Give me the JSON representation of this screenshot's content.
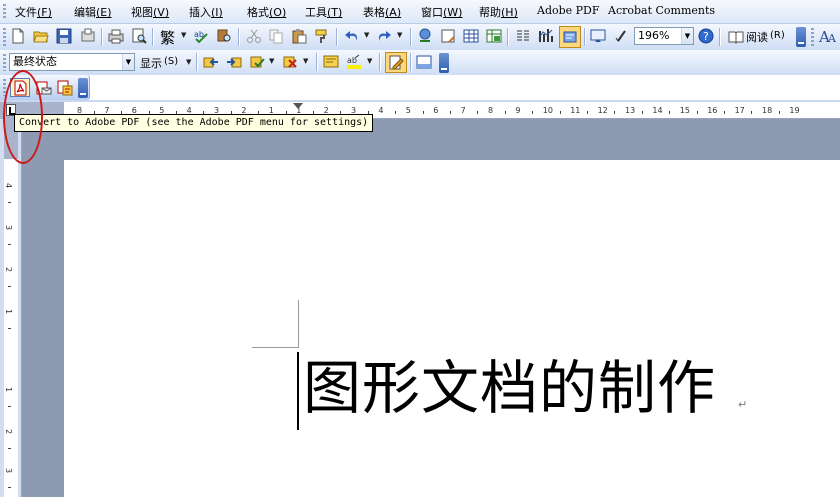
{
  "menubar": {
    "items": [
      {
        "label": "文件",
        "mnemonic": "(F)"
      },
      {
        "label": "编辑",
        "mnemonic": "(E)"
      },
      {
        "label": "视图",
        "mnemonic": "(V)"
      },
      {
        "label": "插入",
        "mnemonic": "(I)"
      },
      {
        "label": "格式",
        "mnemonic": "(O)"
      },
      {
        "label": "工具",
        "mnemonic": "(T)"
      },
      {
        "label": "表格",
        "mnemonic": "(A)"
      },
      {
        "label": "窗口",
        "mnemonic": "(W)"
      },
      {
        "label": "帮助",
        "mnemonic": "(H)"
      },
      {
        "label": "Adobe PDF",
        "mnemonic": ""
      },
      {
        "label": "Acrobat Comments",
        "mnemonic": ""
      }
    ]
  },
  "standard_toolbar": {
    "traditional_label": "繁",
    "zoom_value": "196%",
    "read_label": "阅读",
    "read_mnemonic": "(R)"
  },
  "reviewing_toolbar": {
    "display_mode": "最终状态",
    "show_label": "显示",
    "show_mnemonic": "(S)"
  },
  "ruler": {
    "numbers": [
      "8",
      "7",
      "6",
      "5",
      "4",
      "3",
      "2",
      "1",
      "1",
      "2",
      "3",
      "4",
      "5",
      "6",
      "7",
      "8",
      "9",
      "10",
      "11",
      "12",
      "13",
      "14",
      "15",
      "16",
      "17",
      "18",
      "19"
    ],
    "vertical_numbers": [
      "4",
      "3",
      "2",
      "1",
      "1",
      "2",
      "3"
    ]
  },
  "tooltip": {
    "text": "Convert to Adobe PDF (see the Adobe PDF menu for settings)"
  },
  "document": {
    "text": "图形文档的制作",
    "paragraph_mark": "↵"
  },
  "colors": {
    "annotation_circle": "#cc1a1a",
    "tooltip_bg": "#ffffe1",
    "workspace_bg": "#8e99b2"
  }
}
